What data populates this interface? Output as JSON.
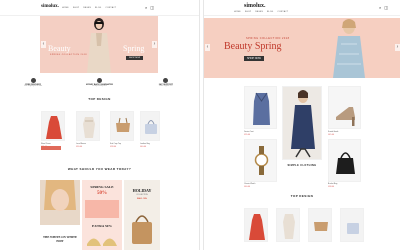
{
  "left": {
    "logo": "simolux.",
    "nav": [
      "HOME",
      "SHOP",
      "PAGES",
      "BLOG",
      "CONTACT"
    ],
    "hero": {
      "word1": "Beauty",
      "word2": "Spring",
      "subtitle": "SPRING COLLECTION 2018",
      "button": "SHOP NOW"
    },
    "services": [
      {
        "title": "FREE DELIVERY",
        "desc": "Free shipping on all order"
      },
      {
        "title": "MONEY BACK GUARANTEE",
        "desc": "30 days money back"
      },
      {
        "title": "24/7 SUPPORT",
        "desc": "Online support 24/7"
      }
    ],
    "section1": "TOP DESIGN",
    "products": [
      {
        "name": "Floral Dress",
        "price": "£25.00",
        "stars": "★★★★★"
      },
      {
        "name": "Lace Blouse",
        "price": "£30.00",
        "stars": "★★★★★"
      },
      {
        "name": "Knit Crop Top",
        "price": "£28.00",
        "stars": "★★★★★"
      },
      {
        "name": "Leather Bag",
        "price": "£40.00",
        "stars": "★★★★★"
      }
    ],
    "section2": "WHAT SHOULD YOU WEAR TODAY?",
    "promo_left": "THE WHITE ON WHITE EDIT",
    "promo_center_top": "SPRING SALE",
    "promo_center_pct": "50%",
    "promo_center_bottom": "EXTRA 50%",
    "promo_right_top": "HOLIDAY",
    "promo_right_sub": "COLLECTION",
    "promo_right_bottom": "SALE - 50%"
  },
  "right": {
    "logo": "simolux.",
    "nav": [
      "HOME",
      "SHOP",
      "PAGES",
      "BLOG",
      "CONTACT"
    ],
    "hero": {
      "subtitle": "SPRING COLLECTION 2018",
      "title": "Beauty Spring",
      "button": "SHOP NOW"
    },
    "featured": "SIMPLE CLOTHING",
    "products": [
      {
        "name": "Denim Coat",
        "price": "£55.00",
        "stars": "★★★★★"
      },
      {
        "name": "Suede Heels",
        "price": "£45.00",
        "stars": "★★★★★"
      },
      {
        "name": "Classic Watch",
        "price": "£60.00",
        "stars": "★★★★★"
      },
      {
        "name": "Bucket Bag",
        "price": "£38.00",
        "stars": "★★★★★"
      }
    ],
    "section": "TOP DESIGN"
  }
}
